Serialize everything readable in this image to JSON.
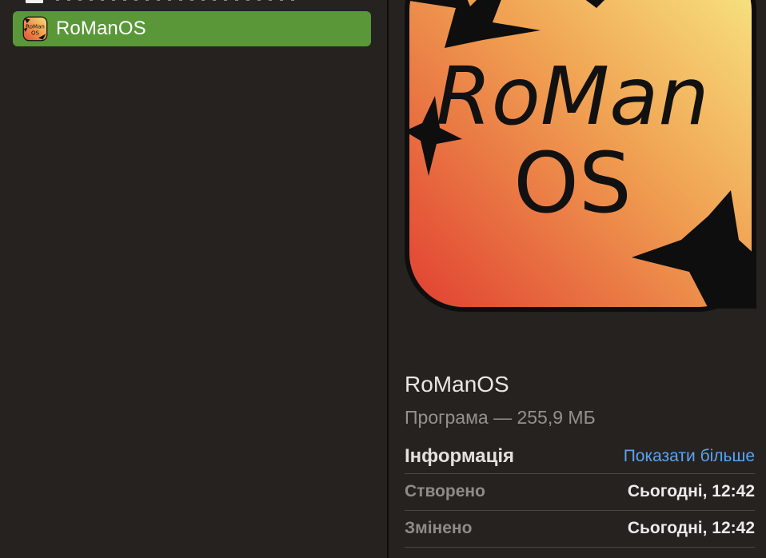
{
  "file_list": {
    "selected_item": {
      "label": "RoManOS",
      "icon": "app-icon-romanos"
    },
    "colors": {
      "selection": "#5a9738",
      "background": "#262220"
    }
  },
  "preview": {
    "icon_text_line1": "RoMan",
    "icon_text_line2": "OS",
    "name": "RoManOS",
    "kind": "Програма — 255,9 МБ",
    "info": {
      "title": "Інформація",
      "show_more_label": "Показати більше",
      "rows": [
        {
          "key": "Створено",
          "value": "Сьогодні, 12:42"
        },
        {
          "key": "Змінено",
          "value": "Сьогодні, 12:42"
        }
      ]
    },
    "colors": {
      "link": "#5aa3f2",
      "gradient_top": "#f7e07a",
      "gradient_bottom": "#e24a33"
    }
  }
}
